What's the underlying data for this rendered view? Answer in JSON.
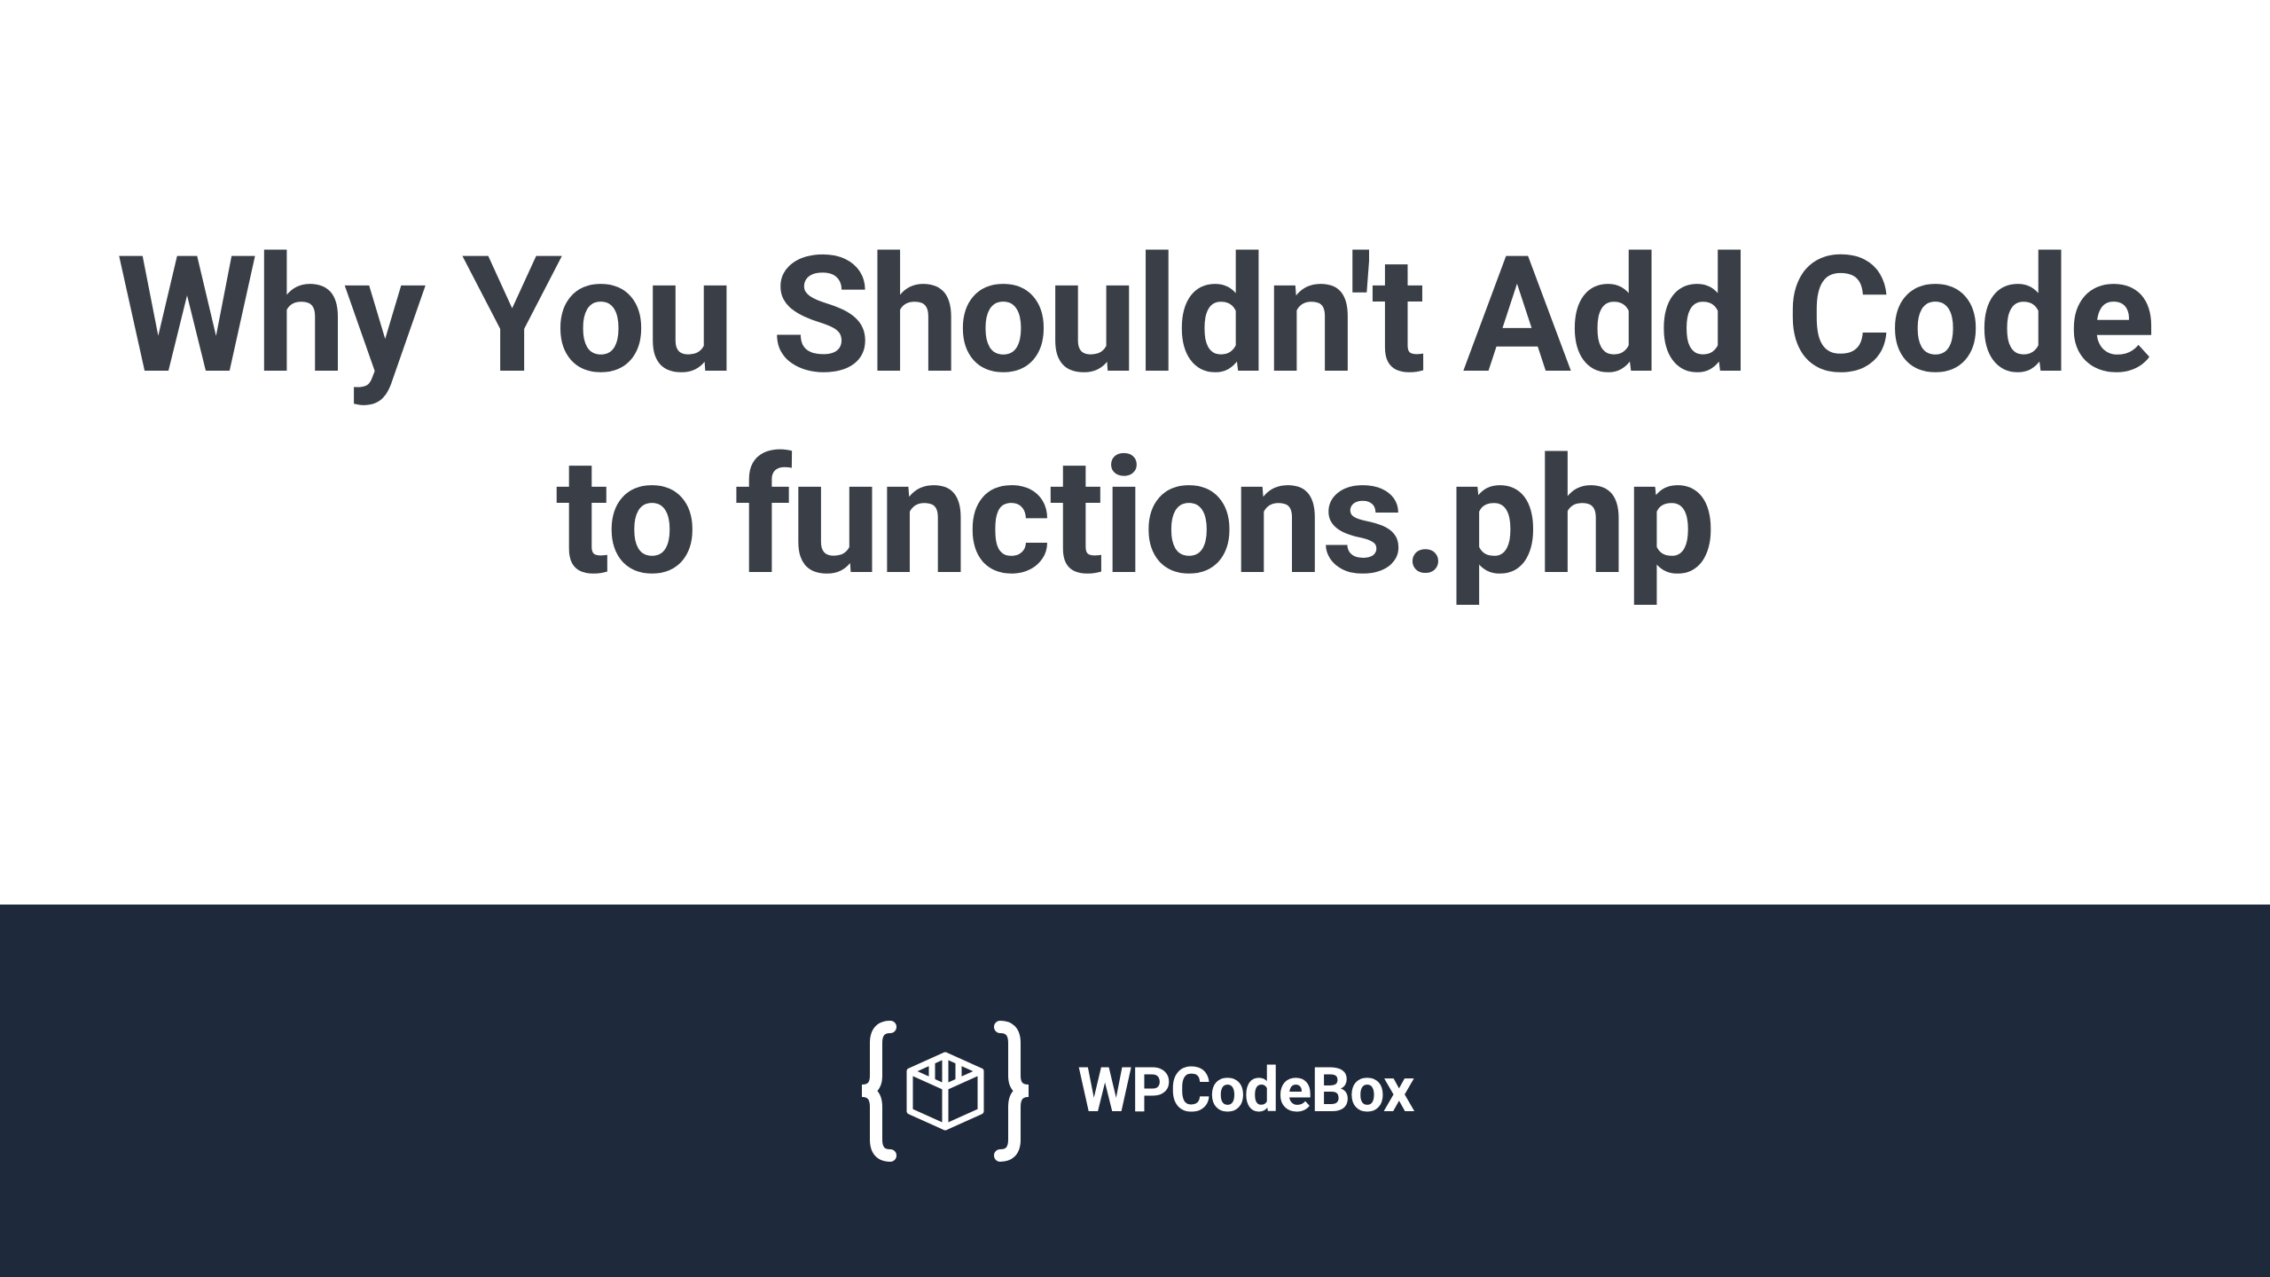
{
  "headline": "Why You Shouldn't Add Code to functions.php",
  "brand": {
    "name": "WPCodeBox"
  },
  "colors": {
    "text_dark": "#3a3f47",
    "footer_bg": "#1e2a3b",
    "text_light": "#ffffff"
  }
}
